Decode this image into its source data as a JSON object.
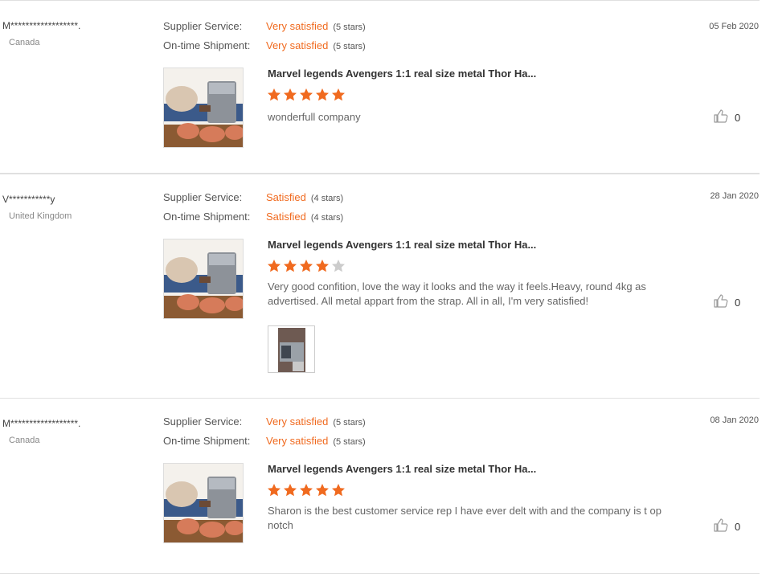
{
  "reviews": [
    {
      "user": "M******************.",
      "country": "Canada",
      "supplier_label": "Supplier Service:",
      "supplier_value": "Very satisfied",
      "supplier_stars": "(5 stars)",
      "shipment_label": "On-time Shipment:",
      "shipment_value": "Very satisfied",
      "shipment_stars": "(5 stars)",
      "date": "05 Feb 2020",
      "product_title": "Marvel legends Avengers 1:1 real size metal Thor Ha...",
      "rating": 5,
      "text": "wonderfull company",
      "helpful_count": "0"
    },
    {
      "user": "V***********y",
      "country": "United Kingdom",
      "supplier_label": "Supplier Service:",
      "supplier_value": "Satisfied",
      "supplier_stars": "(4 stars)",
      "shipment_label": "On-time Shipment:",
      "shipment_value": "Satisfied",
      "shipment_stars": "(4 stars)",
      "date": "28 Jan 2020",
      "product_title": "Marvel legends Avengers 1:1 real size metal Thor Ha...",
      "rating": 4,
      "text": "Very good confition, love the way it looks and the way it feels.Heavy, round 4kg as advertised. All metal appart from the strap. All in all, I'm very satisfied!",
      "helpful_count": "0"
    },
    {
      "user": "M******************.",
      "country": "Canada",
      "supplier_label": "Supplier Service:",
      "supplier_value": "Very satisfied",
      "supplier_stars": "(5 stars)",
      "shipment_label": "On-time Shipment:",
      "shipment_value": "Very satisfied",
      "shipment_stars": "(5 stars)",
      "date": "08 Jan 2020",
      "product_title": "Marvel legends Avengers 1:1 real size metal Thor Ha...",
      "rating": 5,
      "text": "Sharon is the best customer service rep I have ever delt with and the company is t op notch",
      "helpful_count": "0"
    }
  ],
  "colors": {
    "accent": "#f06a1f",
    "star_filled": "#f06a1f",
    "star_empty": "#cccccc"
  },
  "icons": {
    "helpful": "thumbs-up-icon",
    "star": "star-icon"
  }
}
